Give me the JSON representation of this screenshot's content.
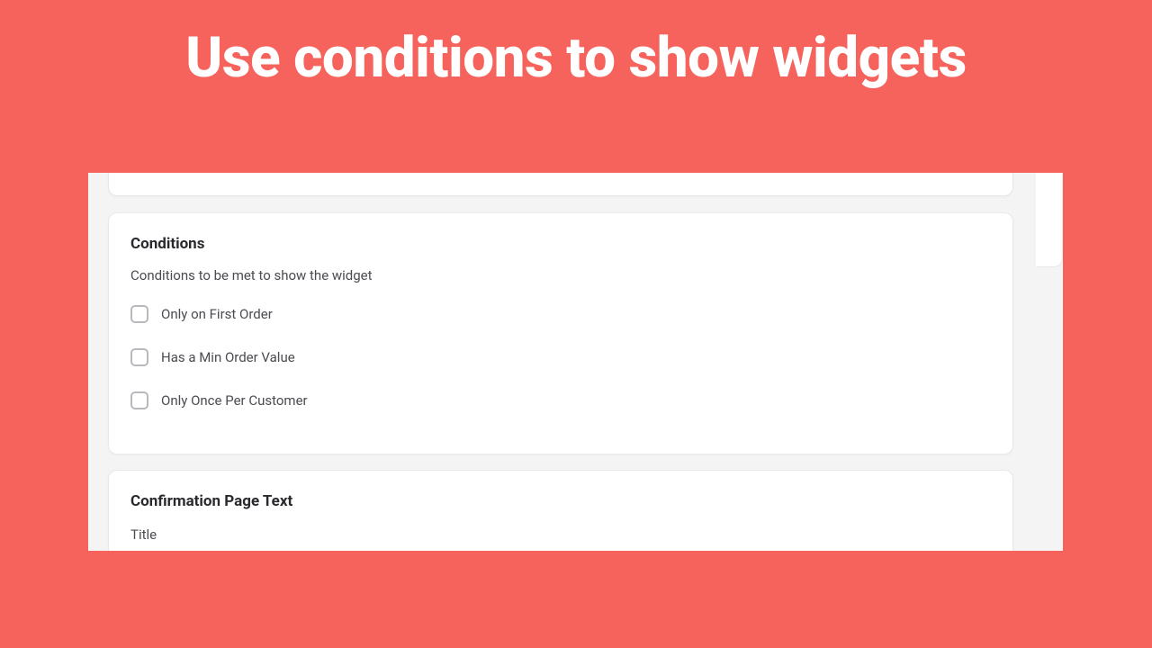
{
  "hero": {
    "title": "Use conditions to show widgets"
  },
  "conditions_card": {
    "title": "Conditions",
    "subtitle": "Conditions to be met to show the widget",
    "items": [
      {
        "label": "Only on First Order"
      },
      {
        "label": "Has a Min Order Value"
      },
      {
        "label": "Only Once Per Customer"
      }
    ]
  },
  "confirm_card": {
    "title": "Confirmation Page Text",
    "field_label": "Title"
  }
}
